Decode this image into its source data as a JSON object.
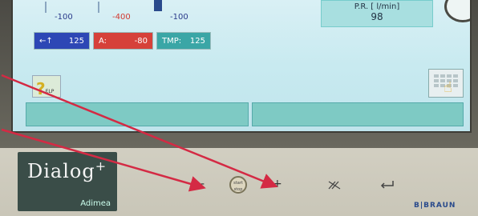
{
  "screen": {
    "scale_labels": [
      {
        "text": "-100",
        "color": "#2a3a8a"
      },
      {
        "text": "-400",
        "color": "#d23a32"
      },
      {
        "text": "-100",
        "color": "#2a3a8a"
      }
    ],
    "pressure_boxes": {
      "venous": {
        "icon": "venous-arrow-icon",
        "symbol": "←↑",
        "value": "125"
      },
      "arterial": {
        "label": "A:",
        "value": "-80"
      },
      "tmp": {
        "label": "TMP:",
        "value": "125"
      }
    },
    "pr_panel": {
      "label": "P.R. [ l/min]",
      "value": "98"
    },
    "help": {
      "symbol": "?",
      "text": "ELP"
    },
    "keypad": {
      "icon": "keypad-hand-icon"
    }
  },
  "front_panel": {
    "brand_main": "Dialog",
    "brand_sup": "+",
    "brand_sub": "Adimea",
    "minus_label": "-",
    "startstop_label_1": "start",
    "startstop_label_2": "stop",
    "plus_label": "+",
    "mute_icon": "alarm-mute-icon",
    "enter_icon": "enter-return-icon",
    "manufacturer": "B|BRAUN"
  },
  "colors": {
    "arrow": "#d42a44",
    "screen_bg": "#c8eaf0",
    "blue_box": "#2d47b5",
    "red_box": "#d6413a",
    "teal_box": "#3aa6a6"
  }
}
